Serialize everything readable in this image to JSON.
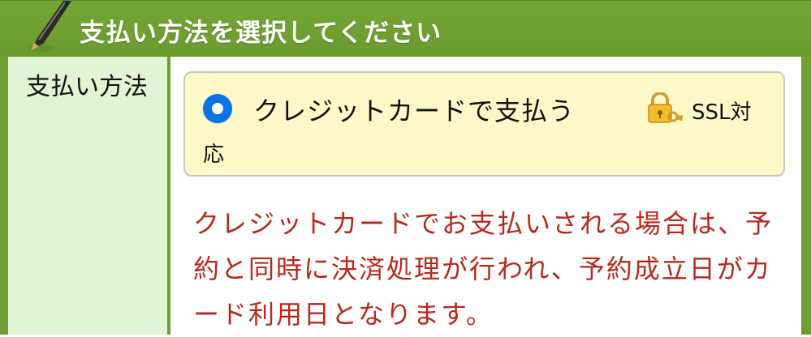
{
  "header": {
    "title": "支払い方法を選択してください"
  },
  "label": {
    "text": "支払い方法"
  },
  "option": {
    "label": "クレジットカードで支払う",
    "ssl_part1": "SSL対",
    "ssl_part2": "応",
    "selected": true
  },
  "notice": {
    "lines": [
      "クレジットカードでお支払いされる場合は、予",
      "約と同時に決済処理が行われ、予約成立日がカ",
      "ード利用日となります。"
    ]
  },
  "colors": {
    "header_green": "#6f9e31",
    "label_bg": "#e3f4d5",
    "option_bg": "#fdf8c8",
    "radio_blue": "#0a73e8",
    "notice_red": "#b52a1e"
  },
  "icons": {
    "header": "pen-icon",
    "ssl": "lock-key-icon"
  }
}
